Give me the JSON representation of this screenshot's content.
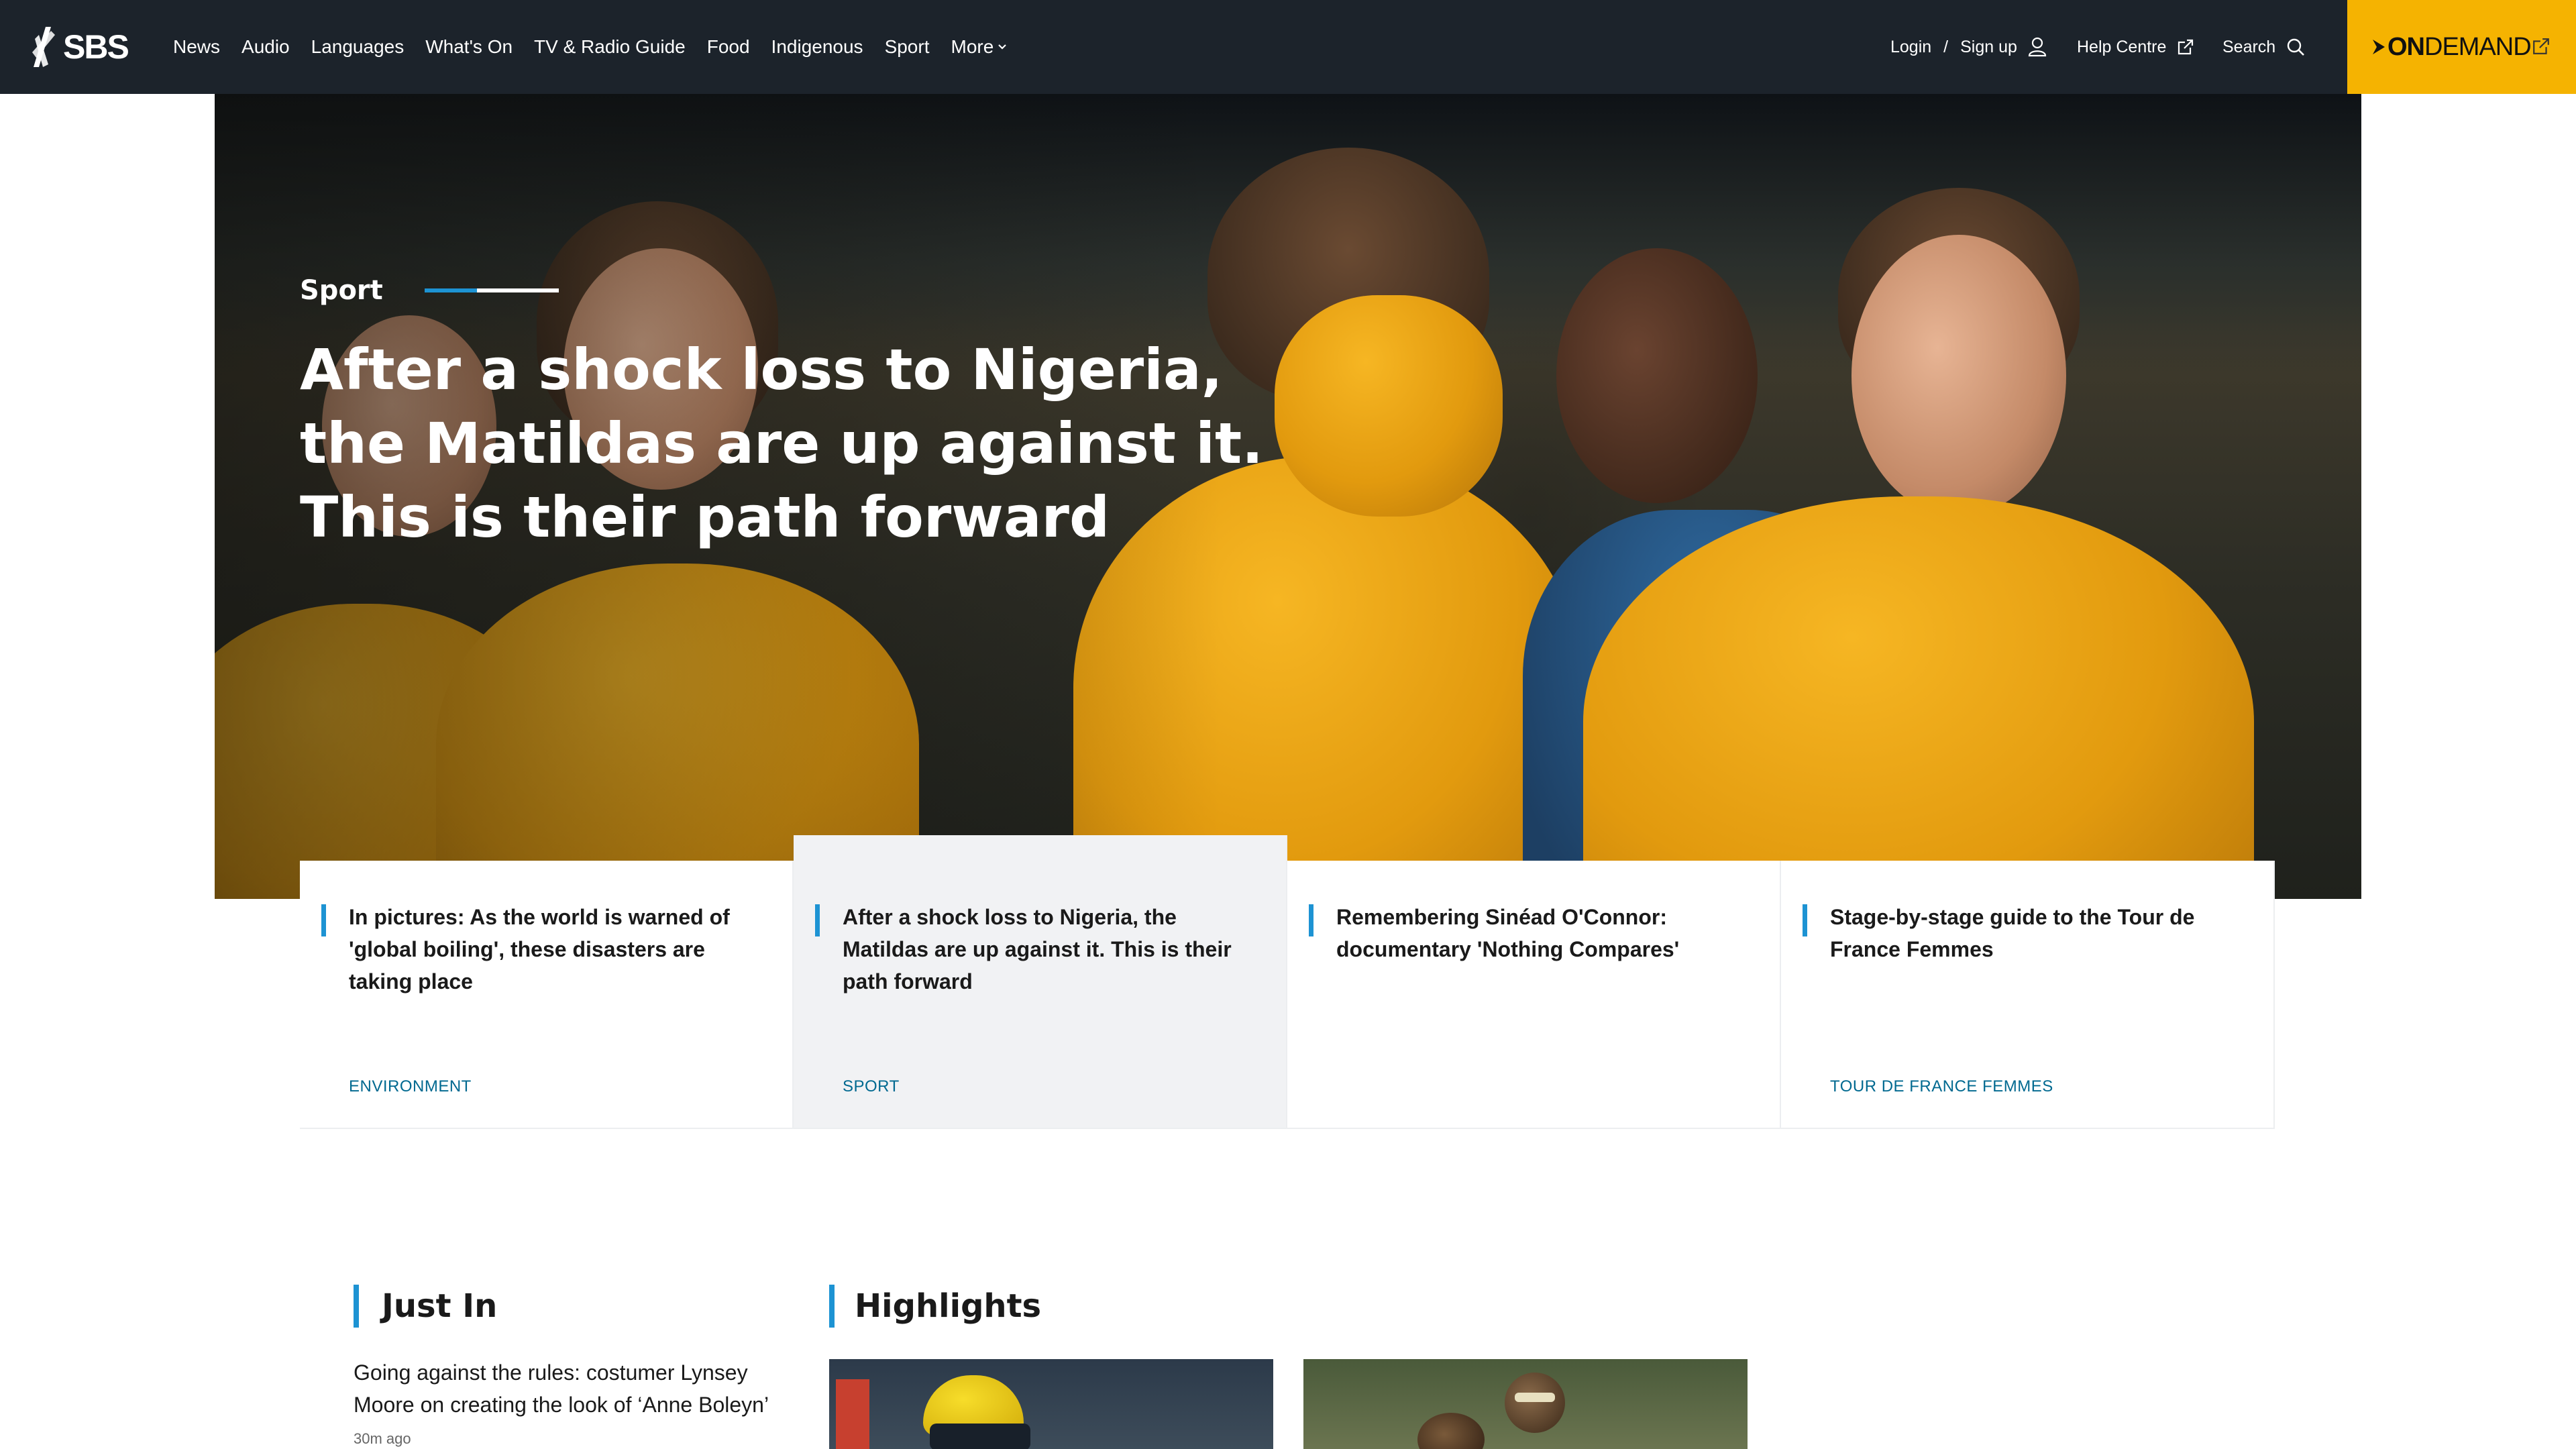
{
  "brand": {
    "logo_text": "SBS"
  },
  "nav": {
    "items": [
      "News",
      "Audio",
      "Languages",
      "What's On",
      "TV & Radio Guide",
      "Food",
      "Indigenous",
      "Sport"
    ],
    "more_label": "More"
  },
  "utility": {
    "login": "Login",
    "separator": "/",
    "signup": "Sign up",
    "help": "Help Centre",
    "search": "Search"
  },
  "ondemand": {
    "on": "ON",
    "demand": "DEMAND",
    "bg_color": "#f5b301"
  },
  "hero": {
    "kicker": "Sport",
    "headline": "After a shock loss to Nigeria, the Matildas are up against it. This is their path forward"
  },
  "cards": [
    {
      "title": "In pictures: As the world is warned of 'global boiling', these disasters are taking place",
      "tag": "ENVIRONMENT",
      "active": false
    },
    {
      "title": "After a shock loss to Nigeria, the Matildas are up against it. This is their path forward",
      "tag": "SPORT",
      "active": true
    },
    {
      "title": "Remembering Sinéad O'Connor: documentary 'Nothing Compares'",
      "tag": "",
      "active": false
    },
    {
      "title": "Stage-by-stage guide to the Tour de France Femmes",
      "tag": "TOUR DE FRANCE FEMMES",
      "active": false
    }
  ],
  "just_in": {
    "heading": "Just In",
    "items": [
      {
        "title": "Going against the rules: costumer Lynsey Moore on creating the look of ‘Anne Boleyn’",
        "time": "30m ago"
      }
    ]
  },
  "highlights": {
    "heading": "Highlights"
  },
  "colors": {
    "accent": "#1d93d3",
    "nav_bg": "#1c232b",
    "tag": "#006990"
  },
  "icons": [
    "sbs-logo-icon",
    "chevron-down-icon",
    "user-icon",
    "external-link-icon",
    "search-icon",
    "ondemand-arrow-icon"
  ]
}
